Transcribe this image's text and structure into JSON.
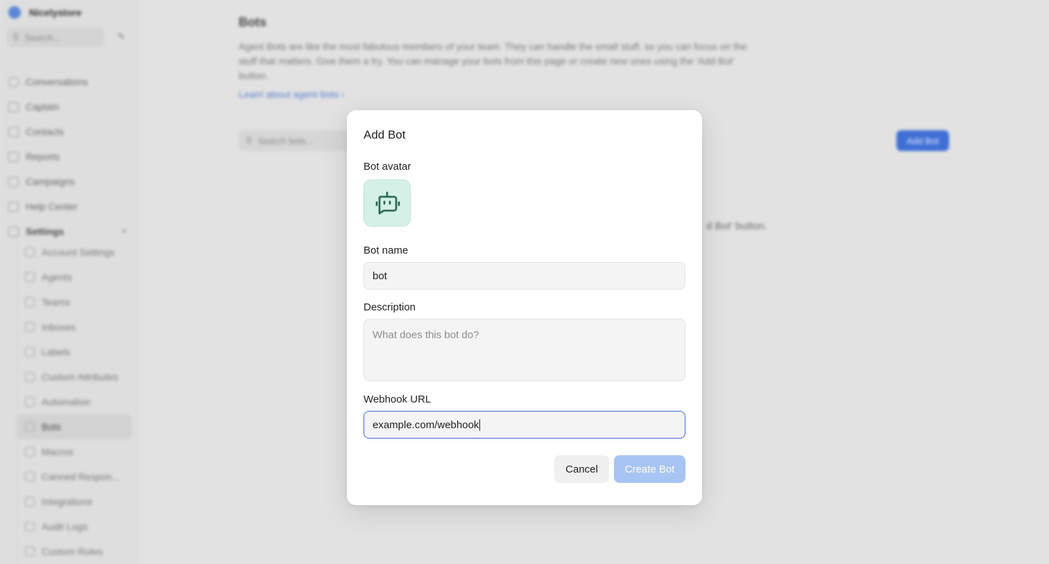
{
  "background": {
    "brand": {
      "name": "Nicelystore"
    },
    "sidebar_search": {
      "placeholder": "Search..."
    },
    "nav": [
      {
        "label": "Conversations",
        "icon": "chat-icon"
      },
      {
        "label": "Captain",
        "icon": "captain-icon"
      },
      {
        "label": "Contacts",
        "icon": "contacts-icon"
      },
      {
        "label": "Reports",
        "icon": "reports-icon"
      },
      {
        "label": "Campaigns",
        "icon": "megaphone-icon"
      },
      {
        "label": "Help Center",
        "icon": "book-icon"
      },
      {
        "label": "Settings",
        "icon": "settings-icon"
      }
    ],
    "settings_items": [
      {
        "label": "Account Settings"
      },
      {
        "label": "Agents"
      },
      {
        "label": "Teams"
      },
      {
        "label": "Inboxes"
      },
      {
        "label": "Labels"
      },
      {
        "label": "Custom Attributes"
      },
      {
        "label": "Automation"
      },
      {
        "label": "Bots",
        "active": true
      },
      {
        "label": "Macros"
      },
      {
        "label": "Canned Respon..."
      },
      {
        "label": "Integrations"
      },
      {
        "label": "Audit Logs"
      },
      {
        "label": "Custom Roles"
      }
    ],
    "page": {
      "title": "Bots",
      "description": "Agent Bots are like the most fabulous members of your team. They can handle the small stuff, so you can focus on the stuff that matters. Give them a try. You can manage your bots from this page or create new ones using the 'Add Bot' button.",
      "learn_link": "Learn about agent bots",
      "search_placeholder": "Search bots...",
      "add_button": "Add Bot",
      "empty_text": "d Bot' button."
    }
  },
  "modal": {
    "title": "Add Bot",
    "avatar_label": "Bot avatar",
    "avatar_icon": "bot-icon",
    "name_label": "Bot name",
    "name_value": "bot",
    "description_label": "Description",
    "description_placeholder": "What does this bot do?",
    "webhook_label": "Webhook URL",
    "webhook_value": "example.com/webhook",
    "cancel_label": "Cancel",
    "create_label": "Create Bot"
  },
  "colors": {
    "primary": "#3a6ecf",
    "create_disabled": "#a8c4f2",
    "avatar_bg": "#d4f1e8",
    "avatar_icon": "#2f6b57"
  }
}
